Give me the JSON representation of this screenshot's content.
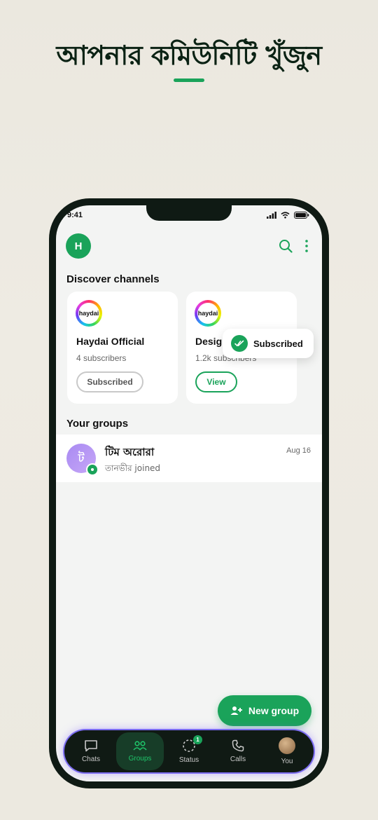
{
  "headline": "আপনার কমিউনিটি খুঁজুন",
  "status_bar": {
    "time": "9:41"
  },
  "header": {
    "avatar_letter": "H"
  },
  "discover": {
    "title": "Discover channels",
    "cards": [
      {
        "logo_text": "haydai",
        "name": "Haydai Official",
        "subscribers": "4 subscribers",
        "button": "Subscribed"
      },
      {
        "logo_text": "haydai",
        "name": "Desig",
        "subscribers": "1.2k subscribers",
        "button": "View"
      }
    ]
  },
  "toast": {
    "label": "Subscribed"
  },
  "groups": {
    "title": "Your groups",
    "items": [
      {
        "avatar_letter": "ট",
        "name": "টিম অরোরা",
        "last_activity": "তানভীর joined",
        "date": "Aug 16"
      }
    ]
  },
  "fab": {
    "label": "New group"
  },
  "nav": {
    "items": [
      {
        "label": "Chats",
        "icon": "chat-icon"
      },
      {
        "label": "Groups",
        "icon": "groups-icon",
        "active": true
      },
      {
        "label": "Status",
        "icon": "status-icon",
        "badge": "1"
      },
      {
        "label": "Calls",
        "icon": "phone-icon"
      },
      {
        "label": "You",
        "icon": "profile-avatar"
      }
    ]
  },
  "colors": {
    "accent": "#1aa35a",
    "dark": "#101a14",
    "nav_glow": "#7b6cf0"
  }
}
